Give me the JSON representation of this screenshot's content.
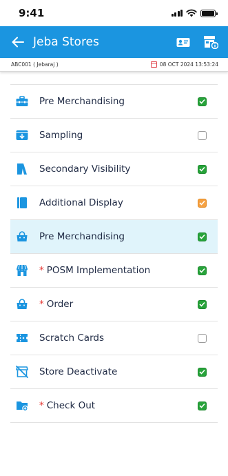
{
  "status_bar": {
    "time": "9:41"
  },
  "header": {
    "title": "Jeba Stores",
    "back_icon": "arrow-left-icon",
    "actions": [
      "id-card-icon",
      "store-info-icon"
    ],
    "color": "#1b95e0"
  },
  "info_strip": {
    "outlet": "ABC001 ( Jebaraj )",
    "datetime": "08 OCT 2024 13:53:24"
  },
  "menu": {
    "items": [
      {
        "label": "Pre Merchandising",
        "icon": "briefcase-icon",
        "required": false,
        "status": "done",
        "active": false
      },
      {
        "label": "Sampling",
        "icon": "inbox-download-icon",
        "required": false,
        "status": "pending",
        "active": false
      },
      {
        "label": "Secondary Visibility",
        "icon": "banner-stand-icon",
        "required": false,
        "status": "done",
        "active": false
      },
      {
        "label": "Additional Display",
        "icon": "display-book-icon",
        "required": false,
        "status": "partial",
        "active": false
      },
      {
        "label": "Pre Merchandising",
        "icon": "shopping-bag-icon",
        "required": false,
        "status": "done",
        "active": true
      },
      {
        "label": "POSM Implementation",
        "icon": "shop-awning-icon",
        "required": true,
        "required_mark": "*",
        "status": "done",
        "active": false
      },
      {
        "label": "Order",
        "icon": "shopping-bag-icon",
        "required": true,
        "required_mark": "*",
        "status": "done",
        "active": false
      },
      {
        "label": "Scratch Cards",
        "icon": "ticket-icon",
        "required": false,
        "status": "pending",
        "active": false
      },
      {
        "label": "Store Deactivate",
        "icon": "store-off-icon",
        "required": false,
        "status": "done",
        "active": false
      },
      {
        "label": "Check Out",
        "icon": "folder-plus-icon",
        "required": true,
        "required_mark": "*",
        "status": "done",
        "active": false
      }
    ]
  },
  "colors": {
    "accent": "#1b95e0",
    "done": "#27a33a",
    "partial": "#f5a142",
    "required": "#e53935",
    "active_row": "#e0f4fb"
  }
}
